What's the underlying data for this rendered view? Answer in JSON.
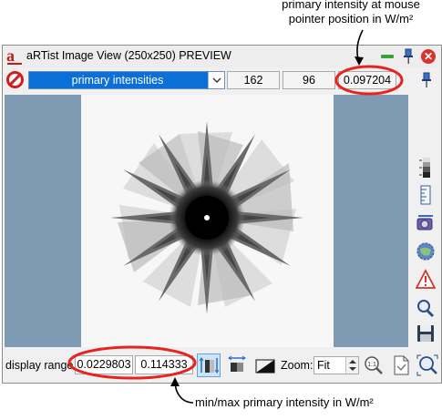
{
  "annotations": {
    "top": "primary intensity at mouse pointer position in W/m²",
    "bottom": "min/max primary intensity in W/m²"
  },
  "window": {
    "title": "aRTist Image View (250x250) PREVIEW",
    "logo_letter": "a",
    "close_glyph": "✕"
  },
  "toolbar": {
    "channel_selected": "primary intensities",
    "pointer_x": "162",
    "pointer_y": "96",
    "pointer_value": "0.097204"
  },
  "bottom": {
    "display_range_label": "display range",
    "range_min": "0.0229803",
    "range_max": "0.114333",
    "zoom_label": "Zoom:",
    "zoom_value": "Fit"
  },
  "colors": {
    "highlight_red": "#e8231f",
    "dropdown_blue": "#0a6fd6",
    "background_steel": "#7f9ab3"
  },
  "icons": [
    "stop-icon",
    "minimize-icon",
    "pin-icon",
    "close-icon",
    "colorbar-icon",
    "ruler-icon",
    "camera-icon",
    "globe-icon",
    "warning-icon",
    "magnifier-icon",
    "save-icon",
    "auto-range-icon",
    "fit-range-icon",
    "gradient-icon",
    "zoom-1to1-icon",
    "new-page-icon",
    "zoom-fit-icon"
  ]
}
